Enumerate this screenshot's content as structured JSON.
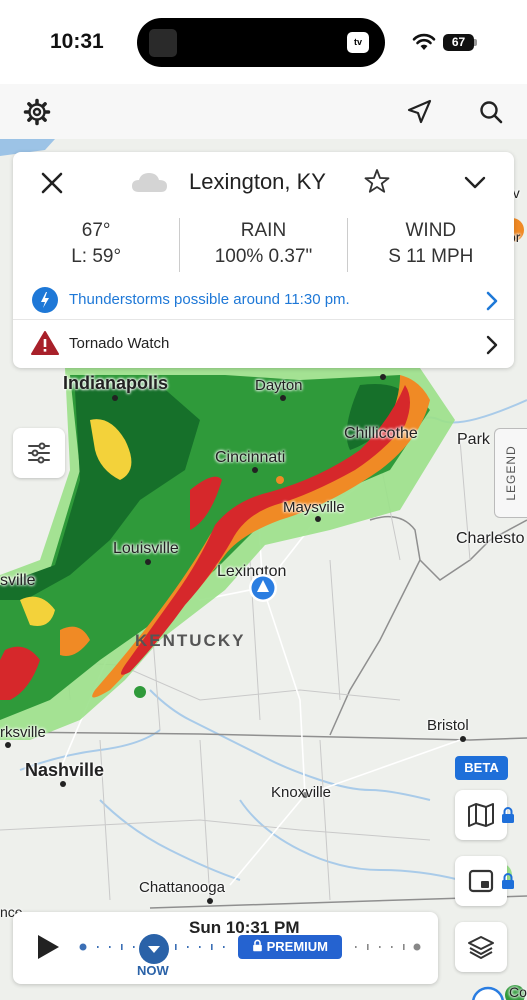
{
  "status_bar": {
    "time": "10:31",
    "battery": "67",
    "island_app": "tv"
  },
  "card": {
    "location": "Lexington, KY",
    "temp": "67°",
    "low": "L: 59°",
    "rain_label": "RAIN",
    "rain_value": "100% 0.37\"",
    "wind_label": "WIND",
    "wind_value": "S 11 MPH",
    "alert_text": "Thunderstorms possible around 11:30 pm.",
    "watch_text": "Tornado Watch"
  },
  "map": {
    "cities": {
      "indianapolis": "Indianapolis",
      "dayton": "Dayton",
      "chillicothe": "Chillicothe",
      "parkersburg": "Park",
      "cincinnati": "Cincinnati",
      "maysville": "Maysville",
      "charleston": "Charlesto",
      "louisville": "Louisville",
      "evansville": "sville",
      "lexington": "Lexington",
      "clarksville": "rksville",
      "bristol": "Bristol",
      "nashville": "Nashville",
      "knoxville": "Knoxville",
      "chattanooga": "Chattanooga",
      "florence": "nce",
      "columbia": "Co",
      "edge_top": "ev",
      "edge_top2": "or"
    },
    "state_label": "KENTUCKY",
    "legend_label": "LEGEND",
    "beta_label": "BETA"
  },
  "timeline": {
    "time": "Sun 10:31 PM",
    "now_label": "NOW",
    "premium_label": "PREMIUM"
  },
  "colors": {
    "accent": "#1e78d7",
    "radar_light": "#9be08a",
    "radar_green": "#2f9a3a",
    "radar_dark_green": "#16702a",
    "radar_yellow": "#f3d23a",
    "radar_orange": "#f08a25",
    "radar_red": "#d6282b"
  },
  "icons": [
    "gear-icon",
    "location-arrow-icon",
    "search-icon",
    "close-icon",
    "cloud-icon",
    "star-icon",
    "chevron-down-icon",
    "thunderstorm-icon",
    "warning-icon",
    "chevron-right-icon",
    "filter-icon",
    "map-icon",
    "picture-in-picture-icon",
    "layers-icon",
    "lock-icon",
    "play-icon",
    "user-location-icon"
  ]
}
